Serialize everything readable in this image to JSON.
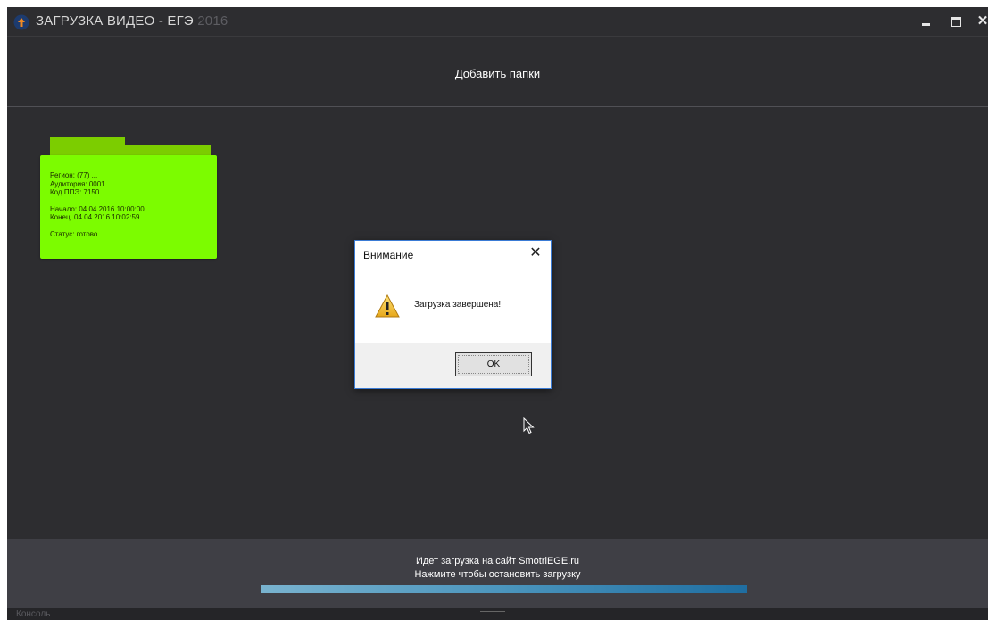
{
  "window": {
    "title": "ЗАГРУЗКА ВИДЕО - ЕГЭ",
    "title_obscured": "2016",
    "minimize_glyph": "",
    "maximize_glyph": "",
    "close_glyph": "✕"
  },
  "header": {
    "add_folders_label": "Добавить папки"
  },
  "folder": {
    "color": "#7cfc00",
    "region": "Регион: (77) ...",
    "auditorium": "Аудитория: 0001",
    "ppe_code": "Код ППЭ: 7150",
    "start": "Начало: 04.04.2016 10:00:00",
    "end": "Конец: 04.04.2016 10:02:59",
    "status": "Статус: готово"
  },
  "dialog": {
    "title": "Внимание",
    "message": "Загрузка завершена!",
    "ok_label": "OK",
    "icon": "warning-icon"
  },
  "status": {
    "line1": "Идет загрузка на сайт SmotriEGE.ru",
    "line2": "Нажмите чтобы остановить загрузку",
    "progress": 1.0
  },
  "console": {
    "label": "Консоль"
  }
}
